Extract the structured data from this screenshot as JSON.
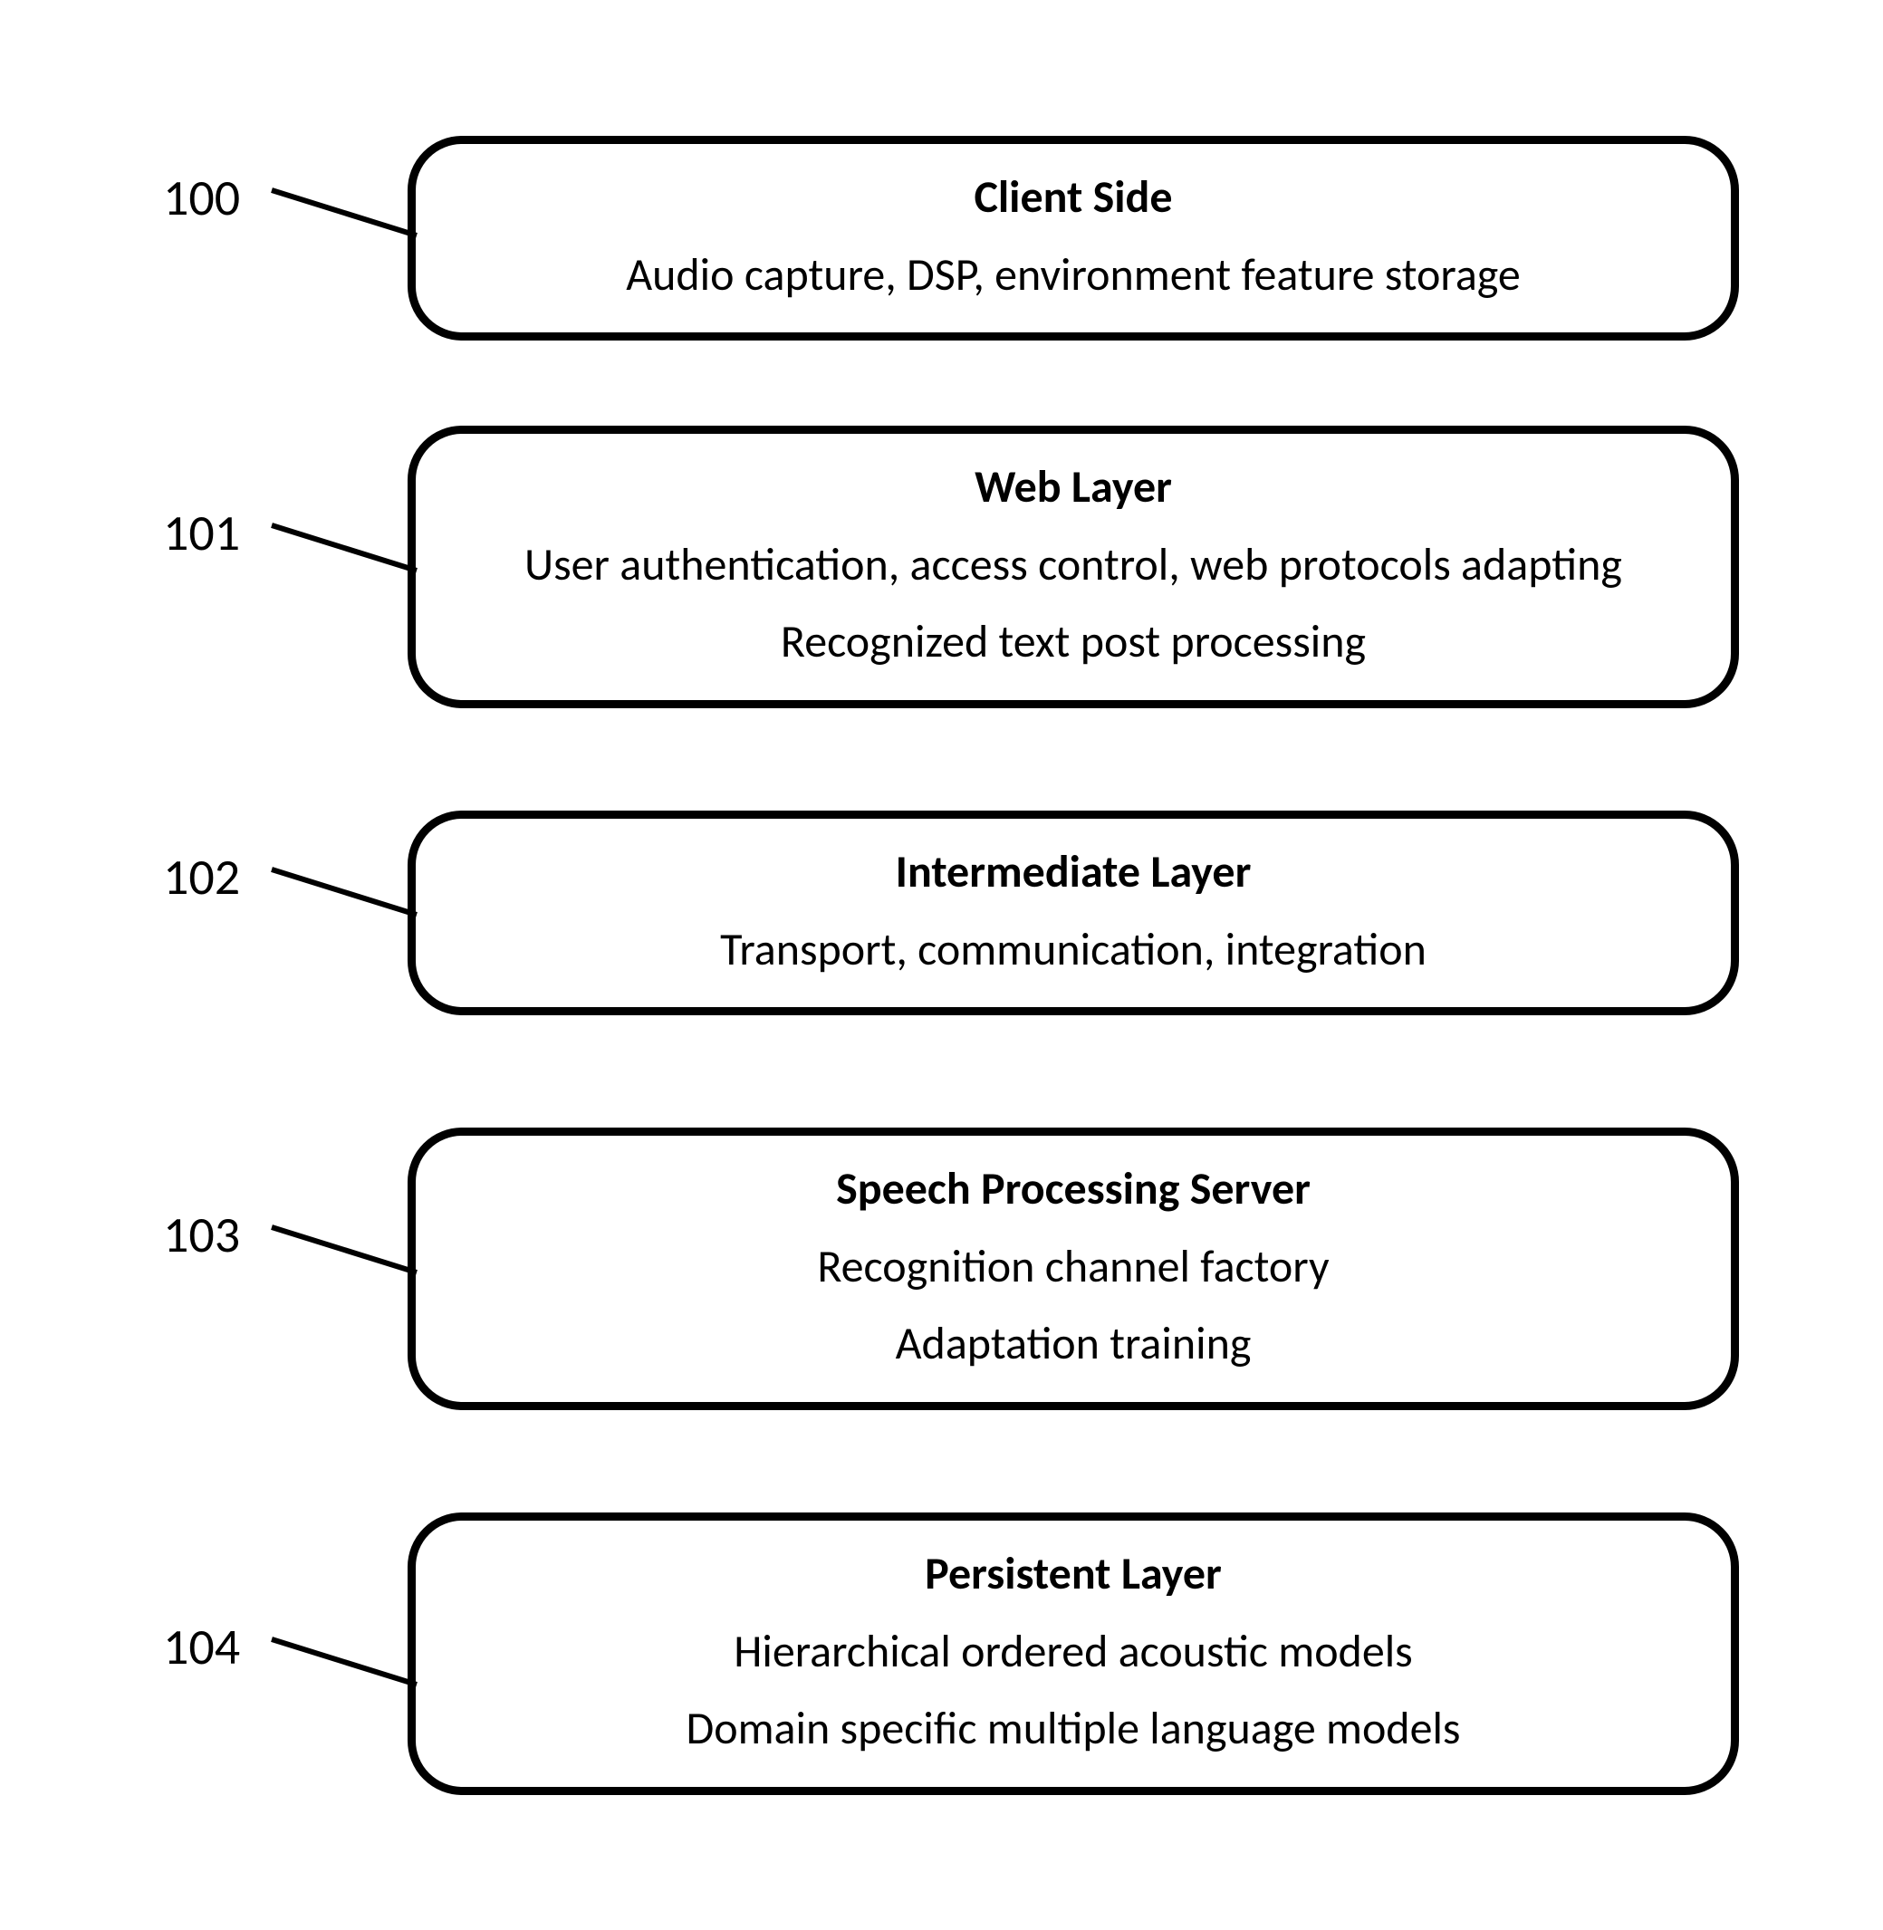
{
  "layers": [
    {
      "ref": "100",
      "title": "Client Side",
      "lines": [
        "Audio capture, DSP, environment feature storage"
      ]
    },
    {
      "ref": "101",
      "title": "Web Layer",
      "lines": [
        "User authentication, access control, web protocols adapting",
        "Recognized text post processing"
      ]
    },
    {
      "ref": "102",
      "title": "Intermediate Layer",
      "lines": [
        "Transport, communication, integration"
      ]
    },
    {
      "ref": "103",
      "title": "Speech Processing Server",
      "lines": [
        "Recognition channel factory",
        "Adaptation training"
      ]
    },
    {
      "ref": "104",
      "title": "Persistent Layer",
      "lines": [
        "Hierarchical ordered acoustic models",
        "Domain specific multiple language models"
      ]
    }
  ]
}
